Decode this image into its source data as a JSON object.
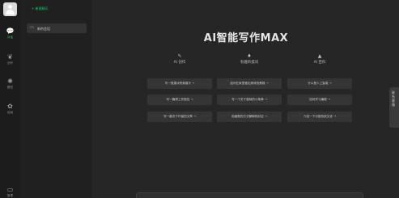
{
  "rail": {
    "items": [
      {
        "icon": "chat-bubble-icon",
        "glyph": "💬",
        "label": "对话",
        "active": true
      },
      {
        "icon": "leaf-icon",
        "glyph": "❦",
        "label": "创作",
        "active": false
      },
      {
        "icon": "brain-icon",
        "glyph": "✺",
        "label": "模型",
        "active": false
      },
      {
        "icon": "palette-icon",
        "glyph": "✿",
        "label": "绘画",
        "active": false
      }
    ],
    "bottom_label": "管理"
  },
  "sidebar": {
    "new_chat_label": "+ 新建聊天",
    "chats": [
      {
        "label": "新的会话"
      }
    ]
  },
  "main": {
    "title": "AI智能写作MAX",
    "columns": [
      {
        "icon": "feather-icon",
        "header": "AI 创作",
        "cards": [
          "写一首唐诗赞美春天 →",
          "写一篇周工作报告 →",
          "写一篇关于环保的文章 →"
        ]
      },
      {
        "icon": "lightbulb-icon",
        "header": "有趣的提问",
        "cards": [
          "如何在家里做出美味的蛋糕 →",
          "写一个关于猫咪的小故事 →",
          "用幽默的方式解释相对论 →"
        ]
      },
      {
        "icon": "graduation-cap-icon",
        "header": "AI 百科",
        "cards": [
          "什么是人工智能 →",
          "如何学习编程 →",
          "介绍一下中国传统文化 →"
        ]
      }
    ]
  },
  "right_tab": {
    "label": "联系客服"
  }
}
